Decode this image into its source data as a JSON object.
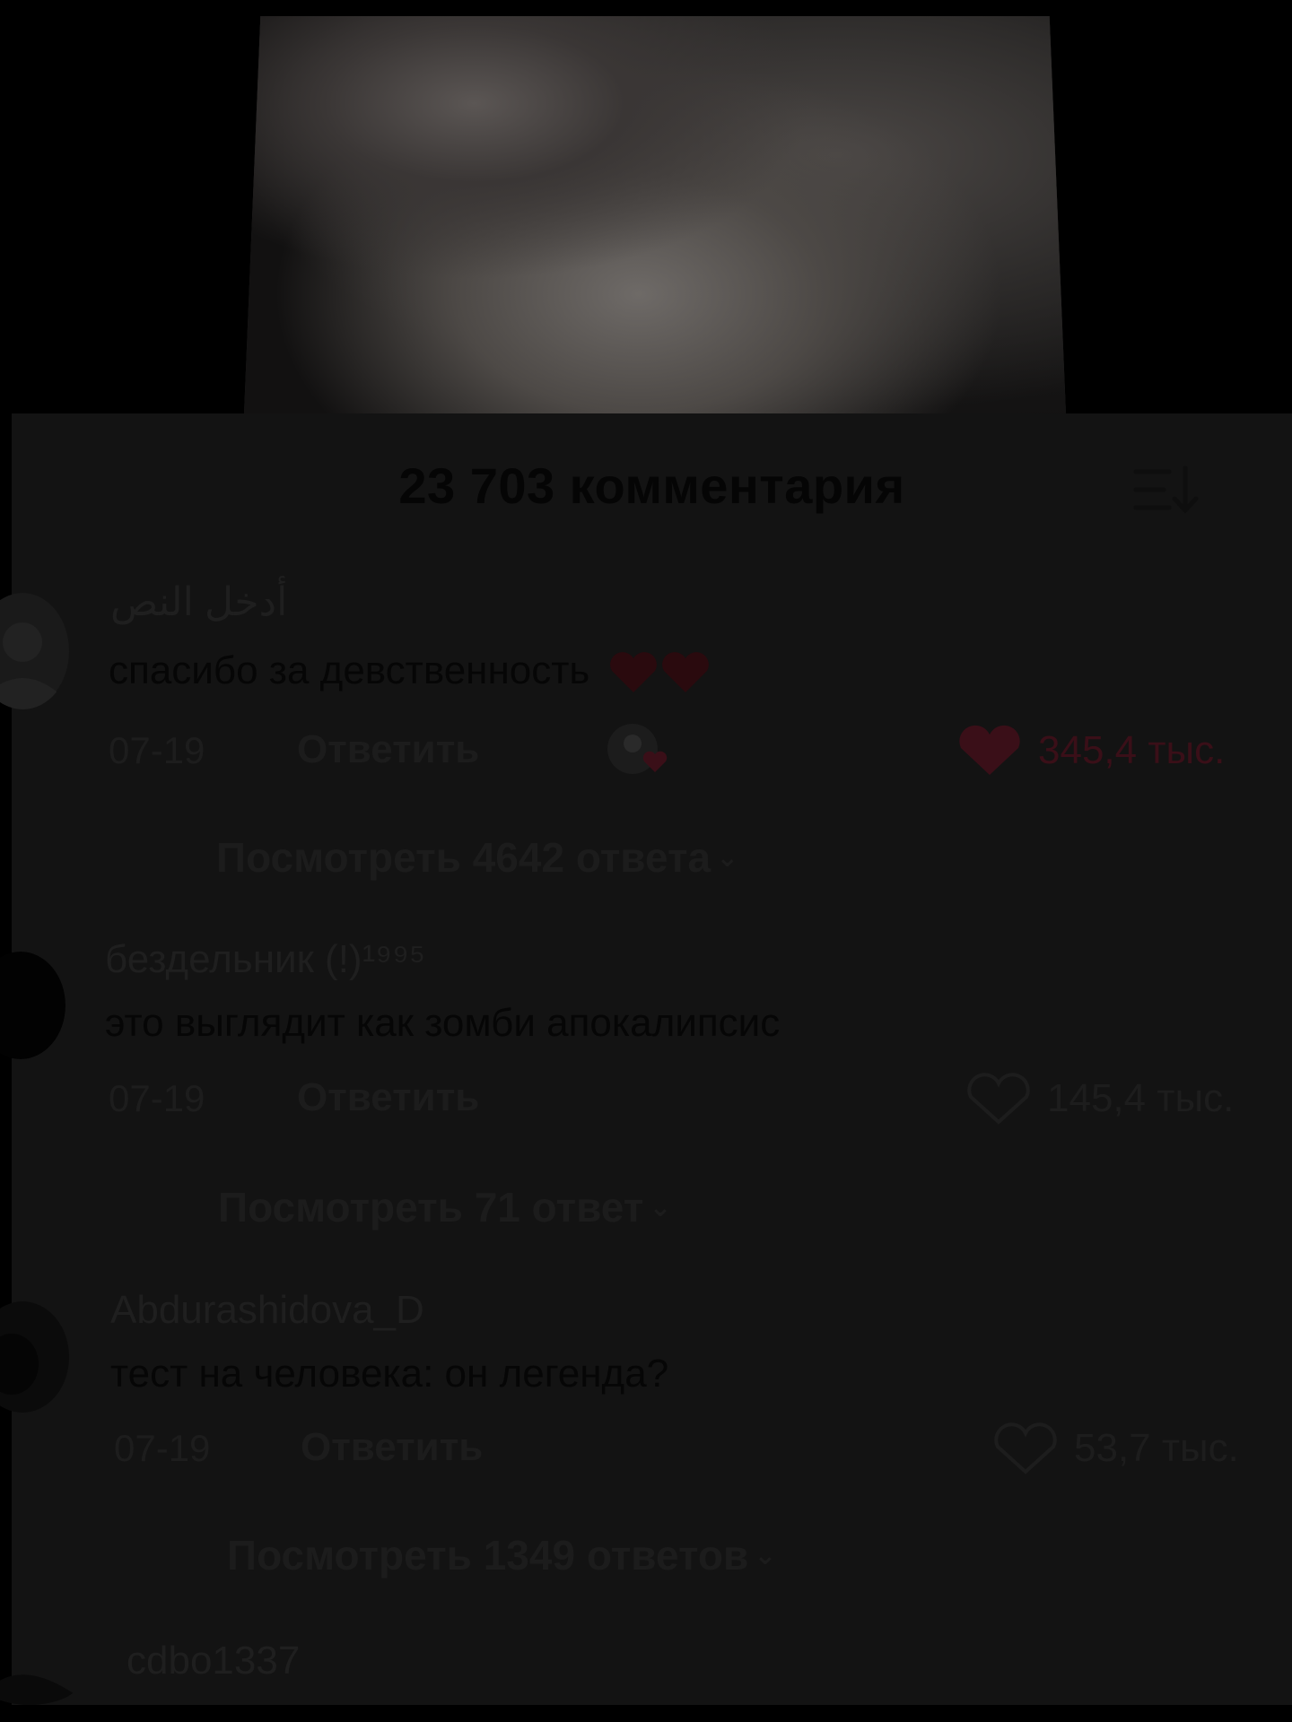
{
  "header": {
    "comment_count_title": "23 703 комментария",
    "sort_icon": "sort-descending-icon"
  },
  "comments": [
    {
      "username": "أدخل النص",
      "text": "спасибо за девственность ❤️❤️",
      "text_plain": "спасибо за девственность",
      "date": "07-19",
      "reply_label": "Ответить",
      "creator_liked": true,
      "liked": true,
      "like_count": "345,4 тыс.",
      "view_replies": "Посмотреть 4642 ответа"
    },
    {
      "username": "бездельник (!)¹⁹⁹⁵",
      "text": "это выглядит как зомби апокалипсис",
      "date": "07-19",
      "reply_label": "Ответить",
      "creator_liked": false,
      "liked": false,
      "like_count": "145,4 тыс.",
      "view_replies": "Посмотреть 71 ответ"
    },
    {
      "username": "Abdurashidova_D",
      "text": "тест на человека: он легенда?",
      "date": "07-19",
      "reply_label": "Ответить",
      "creator_liked": false,
      "liked": false,
      "like_count": "53,7 тыс.",
      "view_replies": "Посмотреть 1349 ответов"
    },
    {
      "username": "cdbo1337"
    }
  ],
  "colors": {
    "background": "#000000",
    "sheet": "#131313",
    "liked_heart": "#3a0f18",
    "outline_heart": "#1d1d1d"
  }
}
